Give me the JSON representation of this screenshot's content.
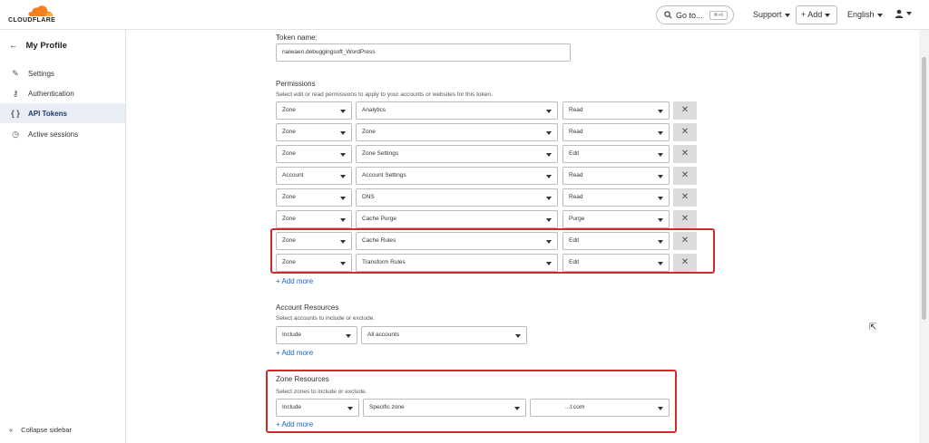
{
  "topbar": {
    "logo_text": "CLOUDFLARE",
    "goto_label": "Go to...",
    "goto_shortcut": "⌘+K",
    "support_label": "Support",
    "add_label": "+ Add",
    "language_label": "English"
  },
  "sidebar": {
    "title": "My Profile",
    "items": [
      {
        "label": "Settings",
        "icon": "pencil-icon"
      },
      {
        "label": "Authentication",
        "icon": "key-icon"
      },
      {
        "label": "API Tokens",
        "icon": "braces-icon"
      },
      {
        "label": "Active sessions",
        "icon": "clock-icon"
      }
    ],
    "collapse_label": "Collapse sidebar"
  },
  "token": {
    "name_label": "Token name:",
    "name_value": "naiwaen.debuggingsoft_WordPress"
  },
  "permissions": {
    "title": "Permissions",
    "description": "Select edit or read permissions to apply to your accounts or websites for this token.",
    "rows": [
      {
        "scope": "Zone",
        "resource": "Analytics",
        "access": "Read"
      },
      {
        "scope": "Zone",
        "resource": "Zone",
        "access": "Read"
      },
      {
        "scope": "Zone",
        "resource": "Zone Settings",
        "access": "Edit"
      },
      {
        "scope": "Account",
        "resource": "Account Settings",
        "access": "Read"
      },
      {
        "scope": "Zone",
        "resource": "DNS",
        "access": "Read"
      },
      {
        "scope": "Zone",
        "resource": "Cache Purge",
        "access": "Purge"
      },
      {
        "scope": "Zone",
        "resource": "Cache Rules",
        "access": "Edit"
      },
      {
        "scope": "Zone",
        "resource": "Transform Rules",
        "access": "Edit"
      }
    ],
    "add_more": "+ Add more"
  },
  "account_resources": {
    "title": "Account Resources",
    "description": "Select accounts to include or exclude.",
    "include": "Include",
    "accounts": "All accounts",
    "add_more": "+ Add more"
  },
  "zone_resources": {
    "title": "Zone Resources",
    "description": "Select zones to include or exclude.",
    "include": "Include",
    "zone_type": "Specific zone",
    "zone_value": "...t.com",
    "add_more": "+ Add more"
  },
  "colors": {
    "accent_link": "#1b63c6",
    "highlight_box": "#d02b2b",
    "logo_orange": "#f38020"
  }
}
